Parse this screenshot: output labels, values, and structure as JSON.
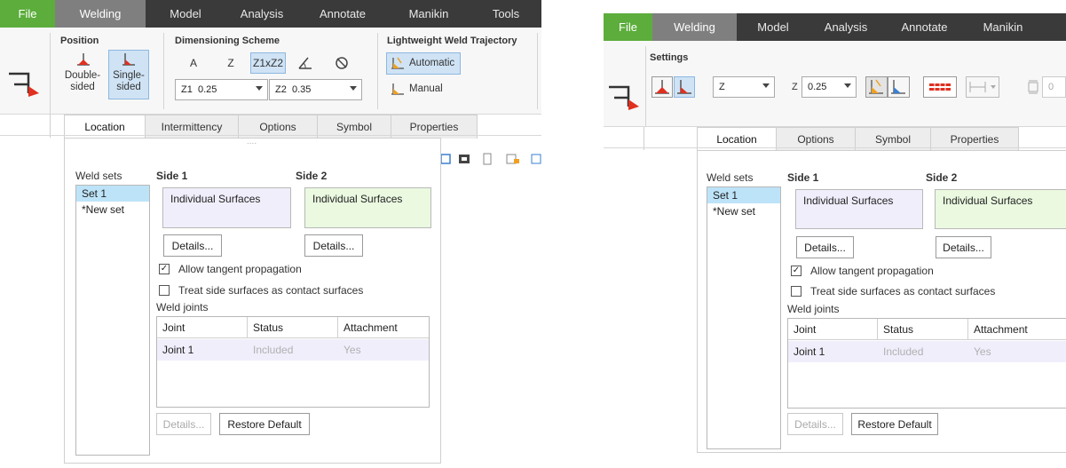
{
  "left": {
    "menu": [
      "File",
      "Welding",
      "Model",
      "Analysis",
      "Annotate",
      "Manikin",
      "Tools"
    ],
    "ribbon": {
      "position_title": "Position",
      "double_sided": "Double-\nsided",
      "single_sided": "Single-\nsided",
      "dimensioning_title": "Dimensioning Scheme",
      "scheme_a": "A",
      "scheme_z": "Z",
      "scheme_z1z2": "Z1xZ2",
      "z1_label": "Z1",
      "z1_value": "0.25",
      "z2_label": "Z2",
      "z2_value": "0.35",
      "lightweight_title": "Lightweight Weld Trajectory",
      "automatic": "Automatic",
      "manual": "Manual"
    },
    "tabs": [
      "Location",
      "Intermittency",
      "Options",
      "Symbol",
      "Properties"
    ],
    "grip": "....",
    "panel": {
      "weld_sets_label": "Weld sets",
      "weld_sets": [
        "Set 1",
        "*New set"
      ],
      "side1": "Side 1",
      "side2": "Side 2",
      "side1_surface": "Individual Surfaces",
      "side2_surface": "Individual Surfaces",
      "details": "Details...",
      "allow_tangent": "Allow tangent propagation",
      "treat_side": "Treat side surfaces as contact surfaces",
      "weld_joints": "Weld joints",
      "columns": [
        "Joint",
        "Status",
        "Attachment"
      ],
      "rows": [
        [
          "Joint 1",
          "Included",
          "Yes"
        ]
      ],
      "restore": "Restore Default"
    }
  },
  "right": {
    "menu": [
      "File",
      "Welding",
      "Model",
      "Analysis",
      "Annotate",
      "Manikin"
    ],
    "ribbon": {
      "settings_title": "Settings",
      "scheme_value": "Z",
      "z_label": "Z",
      "z_value": "0.25",
      "partial_value": "0"
    },
    "tabs": [
      "Location",
      "Options",
      "Symbol",
      "Properties"
    ],
    "panel": {
      "weld_sets_label": "Weld sets",
      "weld_sets": [
        "Set 1",
        "*New set"
      ],
      "side1": "Side 1",
      "side2": "Side 2",
      "side1_surface": "Individual Surfaces",
      "side2_surface": "Individual Surfaces",
      "details": "Details...",
      "allow_tangent": "Allow tangent propagation",
      "treat_side": "Treat side surfaces as contact surfaces",
      "weld_joints": "Weld joints",
      "columns": [
        "Joint",
        "Status",
        "Attachment"
      ],
      "rows": [
        [
          "Joint 1",
          "Included",
          "Yes"
        ]
      ],
      "restore": "Restore Default"
    }
  },
  "colors": {
    "file_tab": "#5cad3c",
    "menubar": "#3a3a3a",
    "active_menu": "#7f7f7f",
    "selection": "#bde3f8",
    "side1_fill": "#f1eefc",
    "side2_fill": "#eaf9e0",
    "weld_red": "#e03020"
  },
  "icons": [
    "weld-feature-icon",
    "double-sided-icon",
    "single-sided-icon",
    "angle-icon",
    "circle-slash-icon",
    "automatic-trajectory-icon",
    "manual-trajectory-icon",
    "toolbar-icons"
  ]
}
